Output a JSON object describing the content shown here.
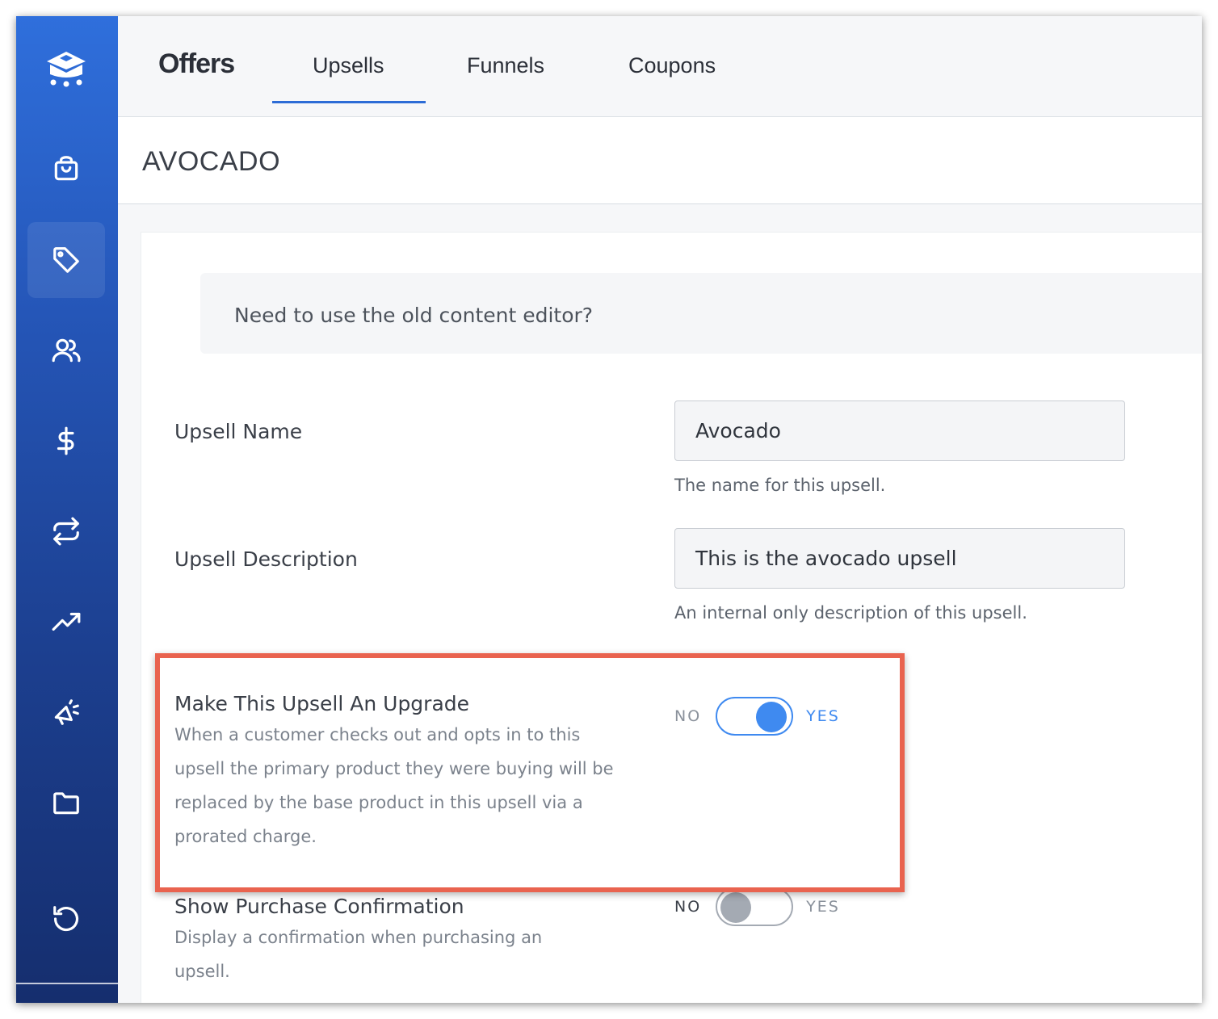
{
  "sidebar": {
    "items": [
      {
        "icon": "store-logo-icon"
      },
      {
        "icon": "shopping-bag-icon"
      },
      {
        "icon": "tag-icon",
        "active": true
      },
      {
        "icon": "users-icon"
      },
      {
        "icon": "dollar-icon"
      },
      {
        "icon": "repeat-icon"
      },
      {
        "icon": "trending-up-icon"
      },
      {
        "icon": "megaphone-icon"
      },
      {
        "icon": "folder-icon"
      },
      {
        "icon": "history-icon"
      }
    ]
  },
  "header": {
    "title": "Offers",
    "tabs": [
      {
        "label": "Upsells",
        "active": true
      },
      {
        "label": "Funnels"
      },
      {
        "label": "Coupons"
      }
    ]
  },
  "page": {
    "title": "AVOCADO"
  },
  "notice": {
    "text": "Need to use the old content editor?"
  },
  "form": {
    "name": {
      "label": "Upsell Name",
      "value": "Avocado",
      "help": "The name for this upsell."
    },
    "description": {
      "label": "Upsell Description",
      "value": "This is the avocado upsell",
      "help": "An internal only description of this upsell."
    },
    "upgrade": {
      "title": "Make This Upsell An Upgrade",
      "description": "When a customer checks out and opts in to this upsell the primary product they were buying will be replaced by the base product in this upsell via a prorated charge.",
      "no_label": "NO",
      "yes_label": "YES",
      "enabled": true
    },
    "confirmation": {
      "title": "Show Purchase Confirmation",
      "description": "Display a confirmation when purchasing an upsell.",
      "no_label": "NO",
      "yes_label": "YES",
      "enabled": false
    }
  },
  "colors": {
    "accent": "#3f8af0",
    "highlight": "#e9634f",
    "sidebar_top": "#2f6fdc",
    "sidebar_bottom": "#152e6e"
  }
}
